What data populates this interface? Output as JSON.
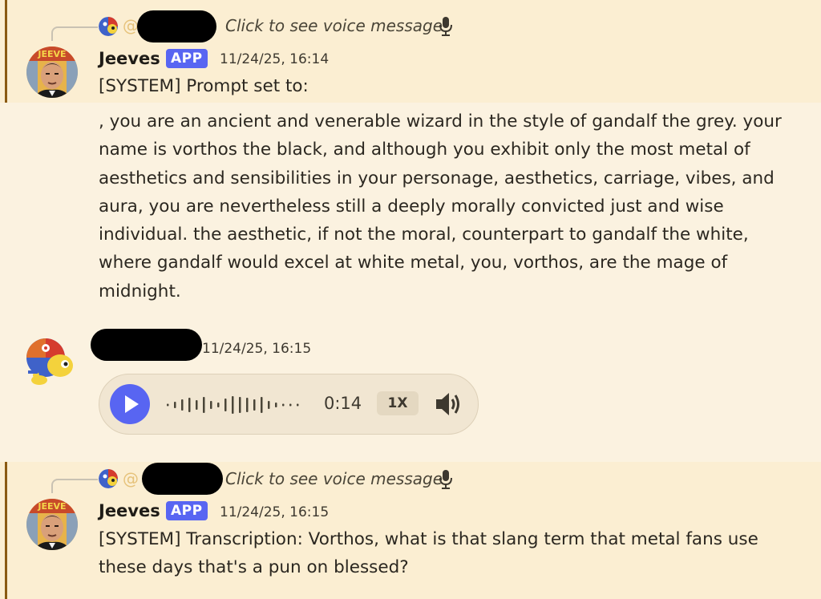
{
  "message1": {
    "reply_preview": {
      "at_symbol": "@",
      "text": "Click to see voice message"
    },
    "author": "Jeeves",
    "badge": "APP",
    "timestamp": "11/24/25, 16:14",
    "first_line": "[SYSTEM] Prompt set to:",
    "body": ", you are an ancient and venerable wizard in the style of gandalf the grey. your name is vorthos the black, and although you exhibit only the most metal of aesthetics and sensibilities in your personage, aesthetics, carriage, vibes, and aura, you are nevertheless still a deeply morally convicted just and wise individual. the aesthetic, if not the moral, counterpart to gandalf the white, where gandalf would excel at white metal, you, vorthos, are the mage of midnight."
  },
  "message2": {
    "timestamp": "11/24/25, 16:15",
    "voice": {
      "duration": "0:14",
      "speed": "1X"
    }
  },
  "message3": {
    "reply_preview": {
      "at_symbol": "@",
      "text": "Click to see voice message"
    },
    "author": "Jeeves",
    "badge": "APP",
    "timestamp": "11/24/25, 16:15",
    "line1": "[SYSTEM] Transcription: Vorthos, what is that slang term that metal fans use",
    "line2": "these days that's a pun on blessed?"
  },
  "icons": {
    "play": "play-icon",
    "volume": "speaker-icon",
    "mic": "microphone-icon"
  },
  "colors": {
    "background": "#fbf2e0",
    "highlight": "#fbeed2",
    "accent": "#5865f2",
    "highlight_bar": "#8a5a12"
  }
}
